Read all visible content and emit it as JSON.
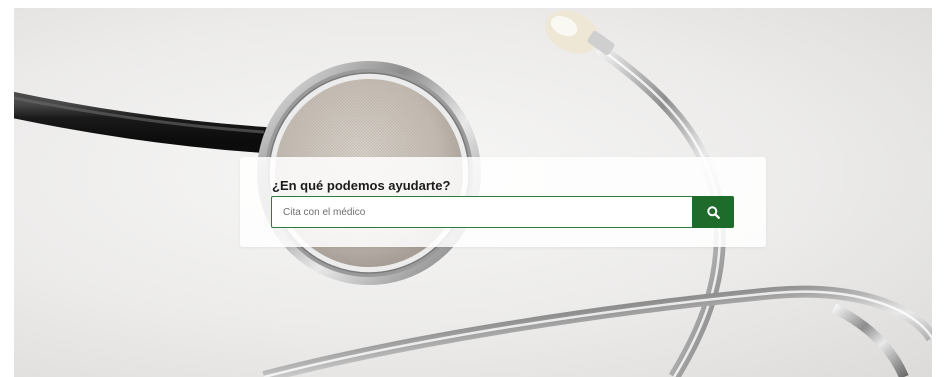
{
  "hero": {
    "image": "stethoscope-photo",
    "heading": "¿En qué podemos ayudarte?"
  },
  "search": {
    "placeholder": "Cita con el médico",
    "value": "",
    "button_icon": "search-icon"
  },
  "colors": {
    "accent_green": "#1e6b2c",
    "input_border": "#2f7a3b",
    "panel_background": "#ffffff",
    "heading_text": "#1c1c1c"
  }
}
